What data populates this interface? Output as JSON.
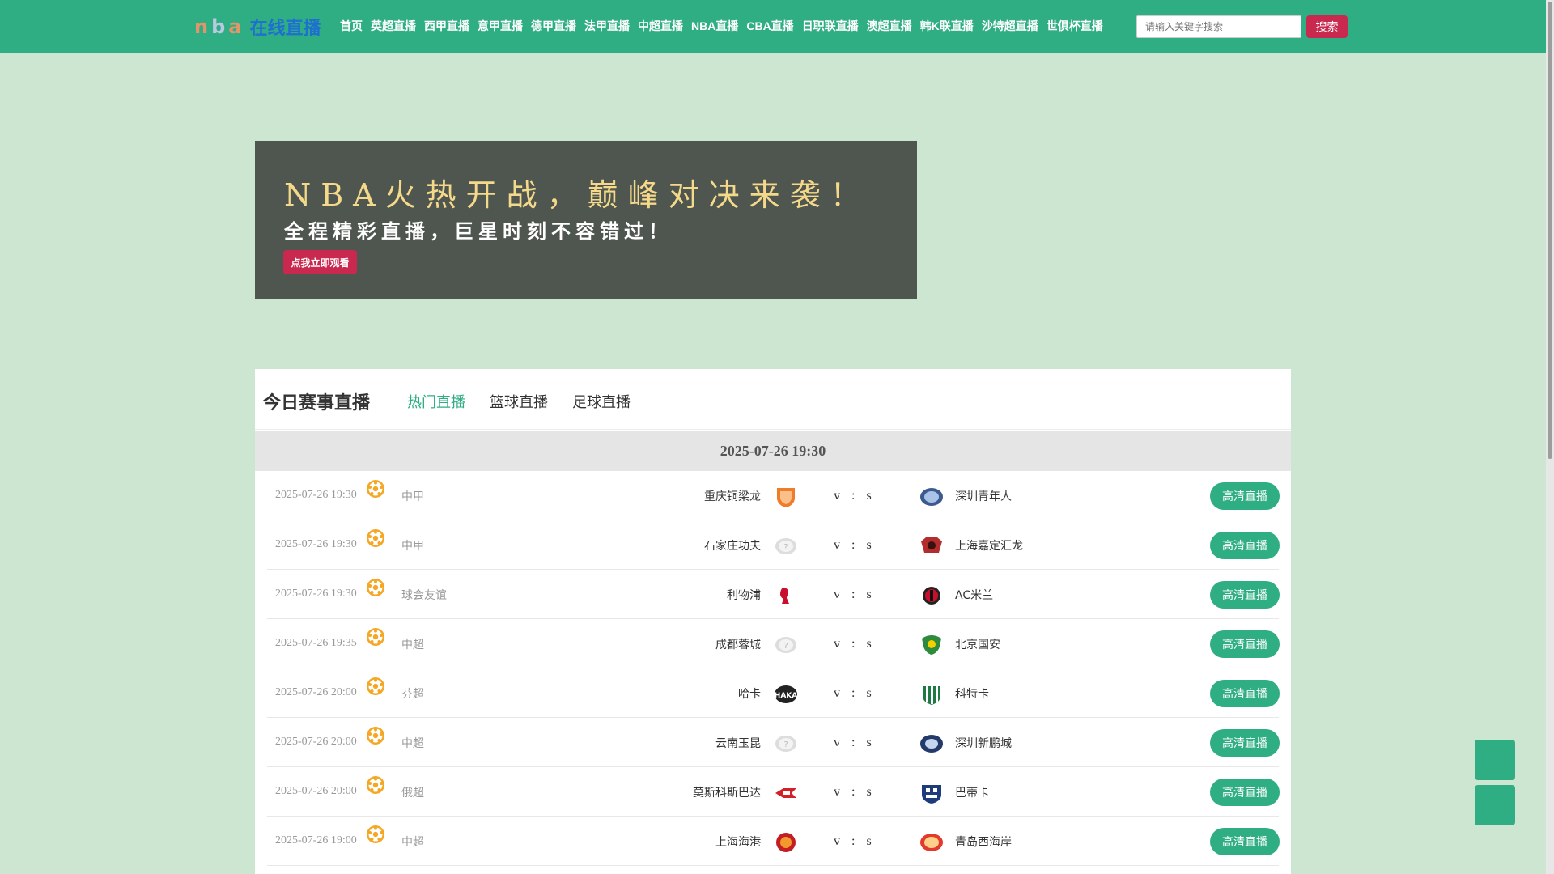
{
  "header": {
    "logo": {
      "p1": "n",
      "p2": "b",
      "p3": "a",
      "p4": "在线直播"
    },
    "nav": [
      "首页",
      "英超直播",
      "西甲直播",
      "意甲直播",
      "德甲直播",
      "法甲直播",
      "中超直播",
      "NBA直播",
      "CBA直播",
      "日职联直播",
      "澳超直播",
      "韩K联直播",
      "沙特超直播",
      "世俱杯直播"
    ],
    "search_placeholder": "请输入关键字搜索",
    "search_button": "搜索"
  },
  "banner": {
    "headline": "NBA火热开战，巅峰对决来袭！",
    "subline": "全程精彩直播，巨星时刻不容错过！",
    "button": "点我立即观看"
  },
  "panel": {
    "title": "今日赛事直播",
    "tabs": [
      "热门直播",
      "篮球直播",
      "足球直播"
    ],
    "active_tab": "热门直播",
    "date_header": "2025-07-26 19:30",
    "vs": {
      "a": "v",
      "b": ":",
      "c": "s"
    },
    "live_label": "高清直播",
    "matches": [
      {
        "time": "2025-07-26 19:30",
        "league": "中甲",
        "home": "重庆铜梁龙",
        "away": "深圳青年人",
        "home_logo": "shield-orange",
        "away_logo": "badge-blue"
      },
      {
        "time": "2025-07-26 19:30",
        "league": "中甲",
        "home": "石家庄功夫",
        "away": "上海嘉定汇龙",
        "home_logo": "unknown",
        "away_logo": "badge-red"
      },
      {
        "time": "2025-07-26 19:30",
        "league": "球会友谊",
        "home": "利物浦",
        "away": "AC米兰",
        "home_logo": "liverbird",
        "away_logo": "badge-acm"
      },
      {
        "time": "2025-07-26 19:35",
        "league": "中超",
        "home": "成都蓉城",
        "away": "北京国安",
        "home_logo": "unknown",
        "away_logo": "badge-green"
      },
      {
        "time": "2025-07-26 20:00",
        "league": "芬超",
        "home": "哈卡",
        "away": "科特卡",
        "home_logo": "badge-black",
        "away_logo": "badge-stripes"
      },
      {
        "time": "2025-07-26 20:00",
        "league": "中超",
        "home": "云南玉昆",
        "away": "深圳新鹏城",
        "home_logo": "unknown",
        "away_logo": "badge-navy"
      },
      {
        "time": "2025-07-26 20:00",
        "league": "俄超",
        "home": "莫斯科斯巴达",
        "away": "巴蒂卡",
        "home_logo": "badge-spartak",
        "away_logo": "badge-shield-navy"
      },
      {
        "time": "2025-07-26 19:00",
        "league": "中超",
        "home": "上海海港",
        "away": "青岛西海岸",
        "home_logo": "badge-red-round",
        "away_logo": "badge-red-orange"
      }
    ]
  },
  "colors": {
    "accent": "#2fad83",
    "brand_red": "#c9284f",
    "bg": "#cde6d2"
  }
}
